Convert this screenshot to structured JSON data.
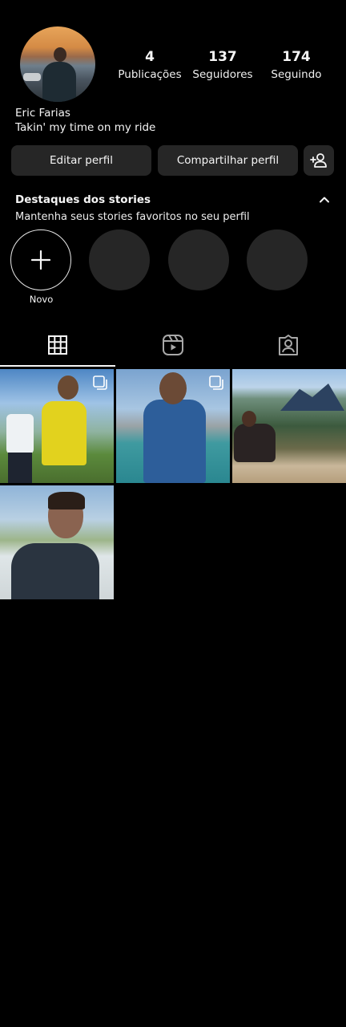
{
  "profile": {
    "name": "Eric Farias",
    "bio": "Takin' my time on my ride"
  },
  "stats": [
    {
      "value": "4",
      "label": "Publicações"
    },
    {
      "value": "137",
      "label": "Seguidores"
    },
    {
      "value": "174",
      "label": "Seguindo"
    }
  ],
  "actions": {
    "edit_label": "Editar perfil",
    "share_label": "Compartilhar perfil"
  },
  "highlights": {
    "title": "Destaques dos stories",
    "subtitle": "Mantenha seus stories favoritos no seu perfil",
    "new_label": "Novo"
  },
  "tabs": [
    {
      "icon": "grid-icon",
      "selected": true
    },
    {
      "icon": "reels-icon",
      "selected": false
    },
    {
      "icon": "tagged-icon",
      "selected": false
    }
  ],
  "colors": {
    "background": "#000000",
    "button_bg": "#262626",
    "text": "#f5f5f5"
  }
}
